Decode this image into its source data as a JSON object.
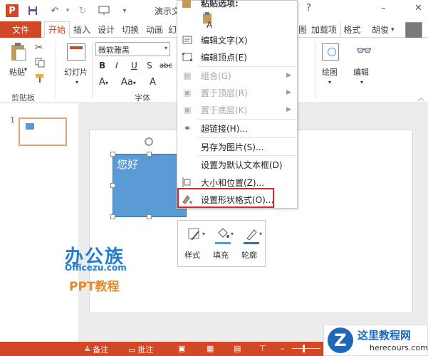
{
  "app": {
    "title": "演示文"
  },
  "titlebar": {
    "app_icon": "P",
    "save_icon": "save-icon",
    "undo_icon": "undo-icon",
    "redo_icon": "redo-icon",
    "more_icon": "chevron-down-icon",
    "help": "?",
    "min": "–",
    "close": "✕"
  },
  "tabs": {
    "file": "文件",
    "items": [
      {
        "label": "开始"
      },
      {
        "label": "插入"
      },
      {
        "label": "设计"
      },
      {
        "label": "切换"
      },
      {
        "label": "动画"
      },
      {
        "label": "幻"
      }
    ],
    "right_items": [
      {
        "label": "图"
      },
      {
        "label": "加载项"
      },
      {
        "label": "格式"
      }
    ],
    "user": "胡俊"
  },
  "ribbon": {
    "paste": "粘贴",
    "clipboard": "剪贴板",
    "slide": "幻灯片",
    "font_name": "微软雅黑",
    "font_group": "字体",
    "bold": "B",
    "italic": "I",
    "underline": "U",
    "shadow": "S",
    "strike": "abc",
    "drawing": "绘图",
    "editing": "编辑"
  },
  "thumbnails": {
    "num": "1"
  },
  "slide": {
    "shape_text": "您好"
  },
  "menu": {
    "top_label": "粘贴选项:",
    "items": [
      {
        "label": "编辑文字(X)",
        "disabled": false,
        "submenu": false
      },
      {
        "label": "编辑顶点(E)",
        "disabled": false,
        "submenu": false
      },
      {
        "label": "组合(G)",
        "disabled": true,
        "submenu": true
      },
      {
        "label": "置于顶层(R)",
        "disabled": true,
        "submenu": true
      },
      {
        "label": "置于底层(K)",
        "disabled": true,
        "submenu": true
      },
      {
        "label": "超链接(H)...",
        "disabled": false,
        "submenu": false
      },
      {
        "label": "另存为图片(S)...",
        "disabled": false,
        "submenu": false
      },
      {
        "label": "设置为默认文本框(D)",
        "disabled": false,
        "submenu": false
      },
      {
        "label": "大小和位置(Z)...",
        "disabled": false,
        "submenu": false
      },
      {
        "label": "设置形状格式(O)...",
        "disabled": false,
        "submenu": false
      }
    ]
  },
  "minibar": {
    "style": "样式",
    "fill": "填充",
    "outline": "轮廓"
  },
  "logo": {
    "main": "办公族",
    "sub": "Officezu.com",
    "ppt": "PPT教程"
  },
  "statusbar": {
    "notes": "备注",
    "comments": "批注"
  },
  "corner": {
    "z": "Z",
    "title": "这里教程网",
    "url": "herecours.com"
  },
  "colors": {
    "accent": "#d24726",
    "shape": "#5b9bd5",
    "highlight": "#d9232d"
  }
}
